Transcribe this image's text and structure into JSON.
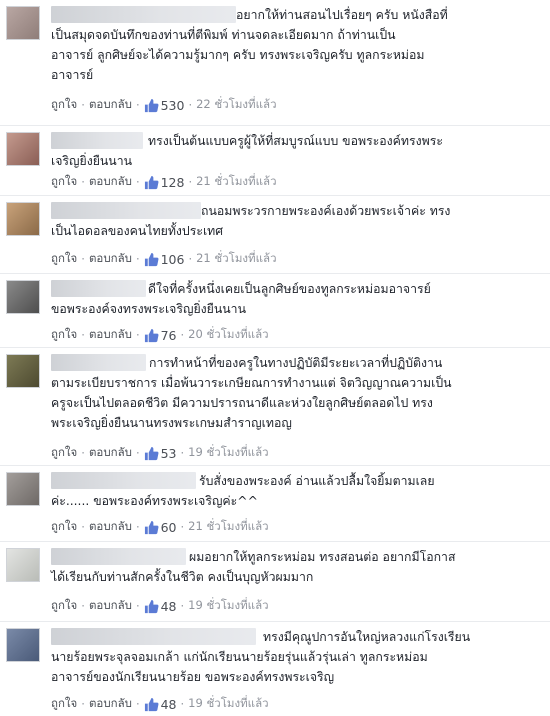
{
  "labels": {
    "like": "ถูกใจ",
    "reply": "ตอบกลับ"
  },
  "colors": {
    "link": "#365899",
    "meta": "#90949c",
    "text": "#1d2129",
    "thumb_fill": "#5b7bd5"
  },
  "comments": [
    {
      "text": "อยากให้ท่านสอนไปเรื่อยๆ ครับ หนังสือที่\nเป็นสมุดจดบันทึกของท่านที่ตีพิมพ์ ท่านจดละเอียดมาก ถ้าท่านเป็น\nอาจารย์ ลูกศิษย์จะได้ความรู้มากๆ ครับ ทรงพระเจริญครับ ทูลกระหม่อม\nอาจารย์",
      "likes": "530",
      "time": "22 ชั่วโมงที่แล้ว"
    },
    {
      "text": "ทรงเป็นต้นแบบครูผู้ให้ที่สมบูรณ์แบบ ขอพระองค์ทรงพระ\nเจริญยิ่งยืนนาน",
      "likes": "128",
      "time": "21 ชั่วโมงที่แล้ว"
    },
    {
      "text": "ถนอมพระวรกายพระองค์เองด้วยพระเจ้าค่ะ ทรง\nเป็นไอดอลของคนไทยทั้งประเทศ",
      "likes": "106",
      "time": "21 ชั่วโมงที่แล้ว"
    },
    {
      "text": "ดีใจที่ครั้งหนึ่งเคยเป็นลูกศิษย์ของทูลกระหม่อมอาจารย์\nขอพระองค์จงทรงพระเจริญยิ่งยืนนาน",
      "likes": "76",
      "time": "20 ชั่วโมงที่แล้ว"
    },
    {
      "text": "การทำหน้าที่ของครูในทางปฏิบัติมีระยะเวลาที่ปฏิบัติงาน\nตามระเบียบราชการ เมื่อพ้นวาระเกษียณการทำงานแต่ จิตวิญญาณความเป็น\nครูจะเป็นไปตลอดชีวิต มีความปรารถนาดีและห่วงใยลูกศิษย์ตลอดไป ทรง\nพระเจริญยิ่งยืนนานทรงพระเกษมสำราญเทอญ",
      "likes": "53",
      "time": "19 ชั่วโมงที่แล้ว"
    },
    {
      "text": "รับสั่งของพระองค์ อ่านแล้วปลื้มใจยิ้มตามเลย\nค่ะ...... ขอพระองค์ทรงพระเจริญค่ะ^^",
      "likes": "60",
      "time": "21 ชั่วโมงที่แล้ว"
    },
    {
      "text": "ผมอยากให้ทูลกระหม่อม ทรงสอนต่อ อยากมีโอกาส\nได้เรียนกับท่านสักครั้งในชีวิต คงเป็นบุญหัวผมมาก",
      "likes": "48",
      "time": "19 ชั่วโมงที่แล้ว"
    },
    {
      "text": "ทรงมีคุณูปการอันใหญ่หลวงแก่โรงเรียน\nนายร้อยพระจุลจอมเกล้า แก่นักเรียนนายร้อยรุ่นแล้วรุ่นเล่า ทูลกระหม่อม\nอาจารย์ของนักเรียนนายร้อย ขอพระองค์ทรงพระเจริญ",
      "likes": "48",
      "time": "19 ชั่วโมงที่แล้ว"
    }
  ]
}
